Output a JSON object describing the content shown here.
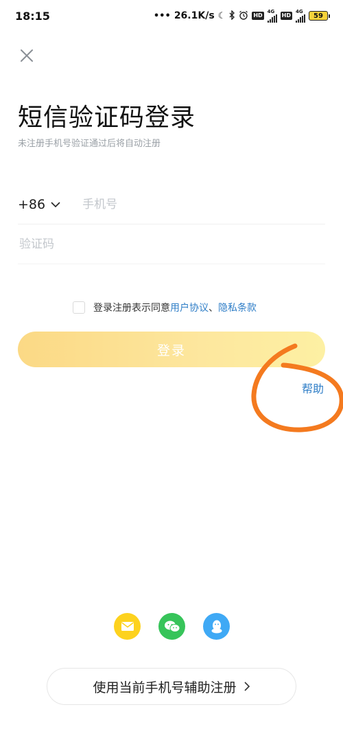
{
  "status_bar": {
    "time": "18:15",
    "network_speed": "26.1K/s",
    "hd_label": "HD",
    "net_type": "4G",
    "battery": "59",
    "icons": [
      "dots-icon",
      "moon-icon",
      "bluetooth-icon",
      "alarm-icon",
      "signal-icon",
      "battery-icon"
    ]
  },
  "header": {
    "close_icon": "close-icon",
    "title": "短信验证码登录",
    "subtitle": "未注册手机号验证通过后将自动注册"
  },
  "form": {
    "country_code": "+86",
    "phone_placeholder": "手机号",
    "code_placeholder": "验证码"
  },
  "agreement": {
    "prefix": "登录注册表示同意",
    "user_agreement": "用户协议",
    "separator": "、",
    "privacy": "隐私条款"
  },
  "login_button": "登录",
  "help": "帮助",
  "social_login": {
    "items": [
      "email-icon",
      "wechat-icon",
      "qq-icon"
    ],
    "colors": {
      "email": "#fdd21e",
      "wechat": "#37c45a",
      "qq": "#3fa9f5"
    }
  },
  "assist_button": "使用当前手机号辅助注册",
  "colors": {
    "accent_link": "#2f7ec7",
    "login_gradient_start": "#fbd985",
    "login_gradient_end": "#fdf0a3",
    "annotation_circle": "#f47a1f"
  }
}
